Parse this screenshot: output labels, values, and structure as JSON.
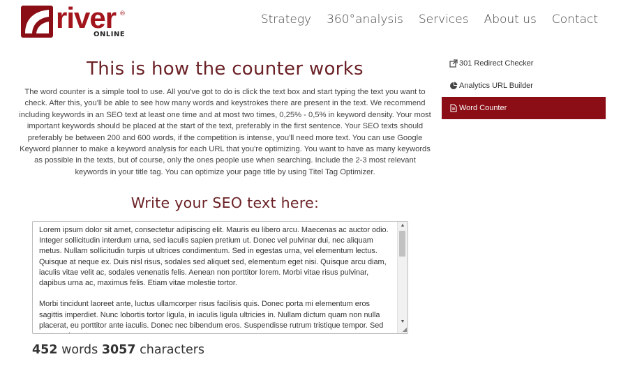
{
  "header": {
    "logo_text": "river",
    "logo_sub": "ONLINE",
    "logo_reg": "®",
    "nav": [
      "Strategy",
      "360°analysis",
      "Services",
      "About us",
      "Contact"
    ]
  },
  "main": {
    "title": "This is how the counter works",
    "intro": "The word counter is a simple tool to use. All you've got to do is click the text box and start typing the text you want to check. After this, you'll be able to see how many words and keystrokes there are present in the text. We recommend including keywords in an SEO text at least one time and at most two times, 0,25% - 0,5% in keyword density. Your most important keywords should be placed at the start of the text, preferably in the first sentence. Your SEO texts should preferably be between 200 and 600 words, if the competition is intense, you'll need more text. You can use Google Keyword planner to make a keyword analysis for each URL that you're optimizing. You want to have as many keywords as possible in the texts, but of course, only the ones people use when searching. Include the 2-3 most relevant keywords in your title tag. You can optimize your page title by using Titel Tag Optimizer.",
    "subtitle": "Write your SEO text here:",
    "textarea_value": "Lorem ipsum dolor sit amet, consectetur adipiscing elit. Mauris eu libero arcu. Maecenas ac auctor odio. Integer sollicitudin interdum urna, sed iaculis sapien pretium ut. Donec vel pulvinar dui, nec aliquam metus. Nullam sollicitudin turpis ut ultrices condimentum. Sed in egestas urna, vel elementum lectus. Quisque at neque ex. Duis nisl risus, sodales sed aliquet sed, elementum eget nisi. Quisque arcu diam, iaculis vitae velit ac, sodales venenatis felis. Aenean non porttitor lorem. Morbi vitae risus pulvinar, dapibus urna ac, maximus felis. Etiam vitae molestie tortor.\n\nMorbi tincidunt laoreet ante, luctus ullamcorper risus facilisis quis. Donec porta mi elementum eros sagittis imperdiet. Nunc lobortis tortor ligula, in iaculis ligula ultricies in. Nullam dictum quam non nulla placerat, eu porttitor ante iaculis. Donec nec bibendum eros. Suspendisse rutrum tristique tempor. Sed auctor mi eget",
    "word_count": "452",
    "words_label": "words",
    "char_count": "3057",
    "chars_label": "characters"
  },
  "sidebar": {
    "items": [
      {
        "label": "301 Redirect Checker",
        "icon": "external-link-icon"
      },
      {
        "label": "Analytics URL Builder",
        "icon": "pie-chart-icon"
      },
      {
        "label": "Word Counter",
        "icon": "document-icon",
        "active": true
      }
    ]
  },
  "colors": {
    "brand": "#8b0e16",
    "heading": "#6b2126"
  }
}
